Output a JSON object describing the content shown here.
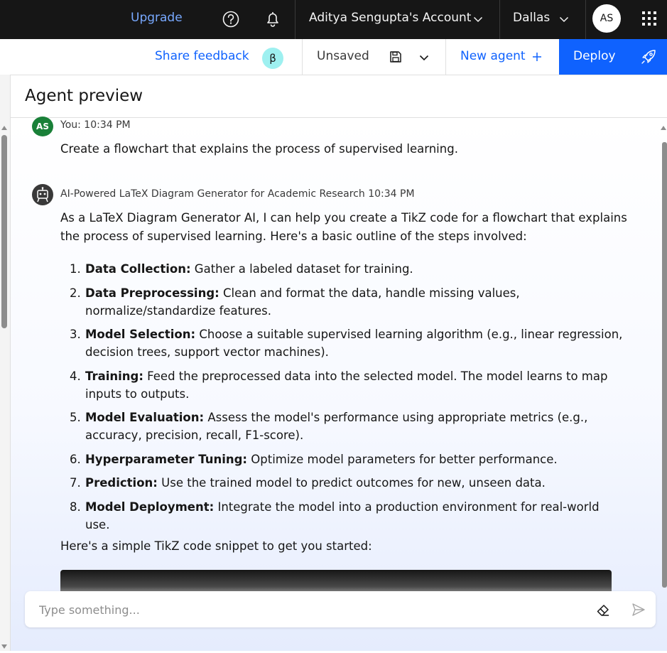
{
  "topbar": {
    "upgrade_label": "Upgrade",
    "account_label": "Aditya Sengupta's Account",
    "region_label": "Dallas",
    "avatar_initials": "AS"
  },
  "toolbar": {
    "feedback_label": "Share feedback",
    "beta_badge": "β",
    "unsaved_label": "Unsaved",
    "new_agent_label": "New agent",
    "deploy_label": "Deploy"
  },
  "preview": {
    "title": "Agent preview"
  },
  "chat": {
    "user": {
      "avatar_initials": "AS",
      "header": "You: 10:34 PM",
      "text": "Create a flowchart that explains the process of supervised learning."
    },
    "bot": {
      "name": "AI-Powered LaTeX Diagram Generator for Academic Research",
      "time": "10:34 PM",
      "intro_line1": "As a LaTeX Diagram Generator AI, I can help you create a TikZ code for a flowchart that explains",
      "intro_line2": "the process of supervised learning. Here's a basic outline of the steps involved:",
      "steps": [
        {
          "num": "1.",
          "bold": "Data Collection:",
          "line1": " Gather a labeled dataset for training.",
          "line2": ""
        },
        {
          "num": "2.",
          "bold": "Data Preprocessing:",
          "line1": " Clean and format the data, handle missing values,",
          "line2": "normalize/standardize features."
        },
        {
          "num": "3.",
          "bold": "Model Selection:",
          "line1": " Choose a suitable supervised learning algorithm (e.g., linear regression,",
          "line2": "decision trees, support vector machines)."
        },
        {
          "num": "4.",
          "bold": "Training:",
          "line1": " Feed the preprocessed data into the selected model. The model learns to map",
          "line2": "inputs to outputs."
        },
        {
          "num": "5.",
          "bold": "Model Evaluation:",
          "line1": " Assess the model's performance using appropriate metrics (e.g.,",
          "line2": "accuracy, precision, recall, F1-score)."
        },
        {
          "num": "6.",
          "bold": "Hyperparameter Tuning:",
          "line1": " Optimize model parameters for better performance.",
          "line2": ""
        },
        {
          "num": "7.",
          "bold": "Prediction:",
          "line1": " Use the trained model to predict outcomes for new, unseen data.",
          "line2": ""
        },
        {
          "num": "8.",
          "bold": "Model Deployment:",
          "line1": " Integrate the model into a production environment for real-world use.",
          "line2": ""
        }
      ],
      "code_intro": "Here's a simple TikZ code snippet to get you started:"
    }
  },
  "input": {
    "placeholder": "Type something..."
  },
  "icons": {
    "help": "help-icon",
    "notification": "bell-icon",
    "apps": "app-switcher-icon",
    "save": "save-icon",
    "new": "plus-icon",
    "deploy": "rocket-icon",
    "bot": "robot-icon",
    "clear": "eraser-icon",
    "send": "send-icon"
  },
  "colors": {
    "topbar_bg": "#161616",
    "link_blue": "#0f62fe",
    "upgrade_blue": "#78a9ff",
    "deploy_bg": "#0f62fe",
    "user_avatar_bg": "#198038",
    "beta_bg": "#9ef0f0"
  }
}
